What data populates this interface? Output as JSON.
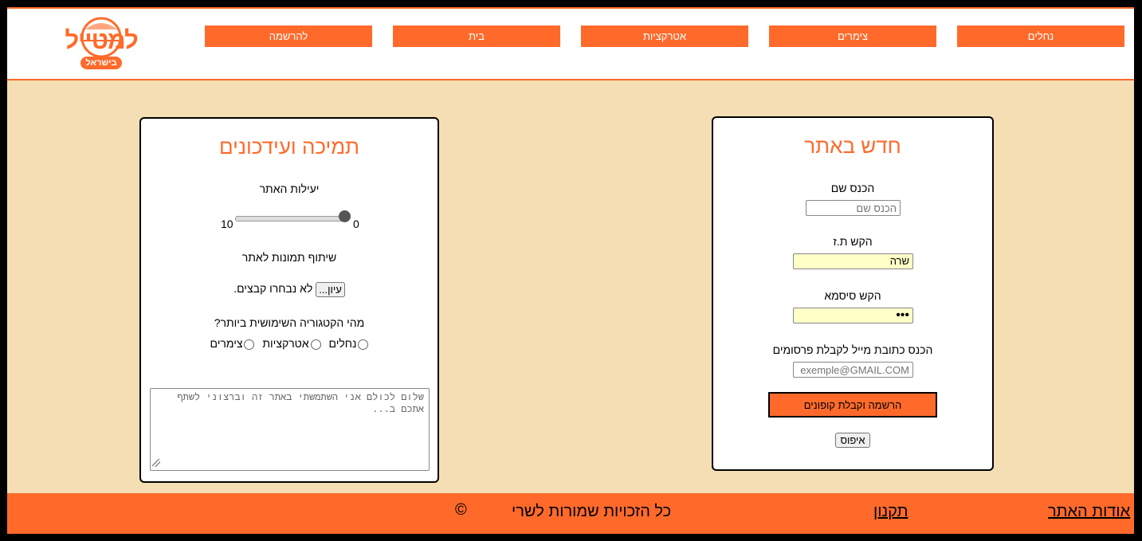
{
  "logo": {
    "line1": "למטייל",
    "line2": "בישראל"
  },
  "nav": {
    "items": [
      "נחלים",
      "צימרים",
      "אטרקציות",
      "בית",
      "להרשמה"
    ]
  },
  "new_card": {
    "title": "חדש באתר",
    "name_label": "הכנס שם",
    "name_placeholder": "הכנס שם",
    "id_label": "הקש ת.ז",
    "id_value": "שרה",
    "password_label": "הקש סיסמא",
    "password_value": "•••",
    "email_label": "הכנס כתובת מייל לקבלת פרסומים",
    "email_placeholder": "exemple@GMAIL.COM",
    "register_button": "הרשמה וקבלת קופונים",
    "reset_button": "איפוס"
  },
  "support_card": {
    "title": "תמיכה ועידכונים",
    "efficiency_label": "יעילות האתר",
    "slider_min": "0",
    "slider_max": "10",
    "slider_value": 0,
    "photos_label": "שיתוף תמונות לאתר",
    "file_button": "עיון...",
    "file_status": "לא נבחרו קבצים.",
    "category_question": "מהי הקטגוריה השימושית ביותר?",
    "categories": [
      "נחלים",
      "אטרקציות",
      "צימרים"
    ],
    "textarea_placeholder": "שלום לכולם אני השתמשתי באתר זה וברצוני לשתף אתכם ב..."
  },
  "footer": {
    "about": "אודות האתר",
    "terms": "תקנון",
    "copyright": "כל הזכויות שמורות לשרי",
    "copyright_symbol": "©"
  },
  "colors": {
    "accent": "#ff6a2b",
    "background": "#f5deb3"
  }
}
